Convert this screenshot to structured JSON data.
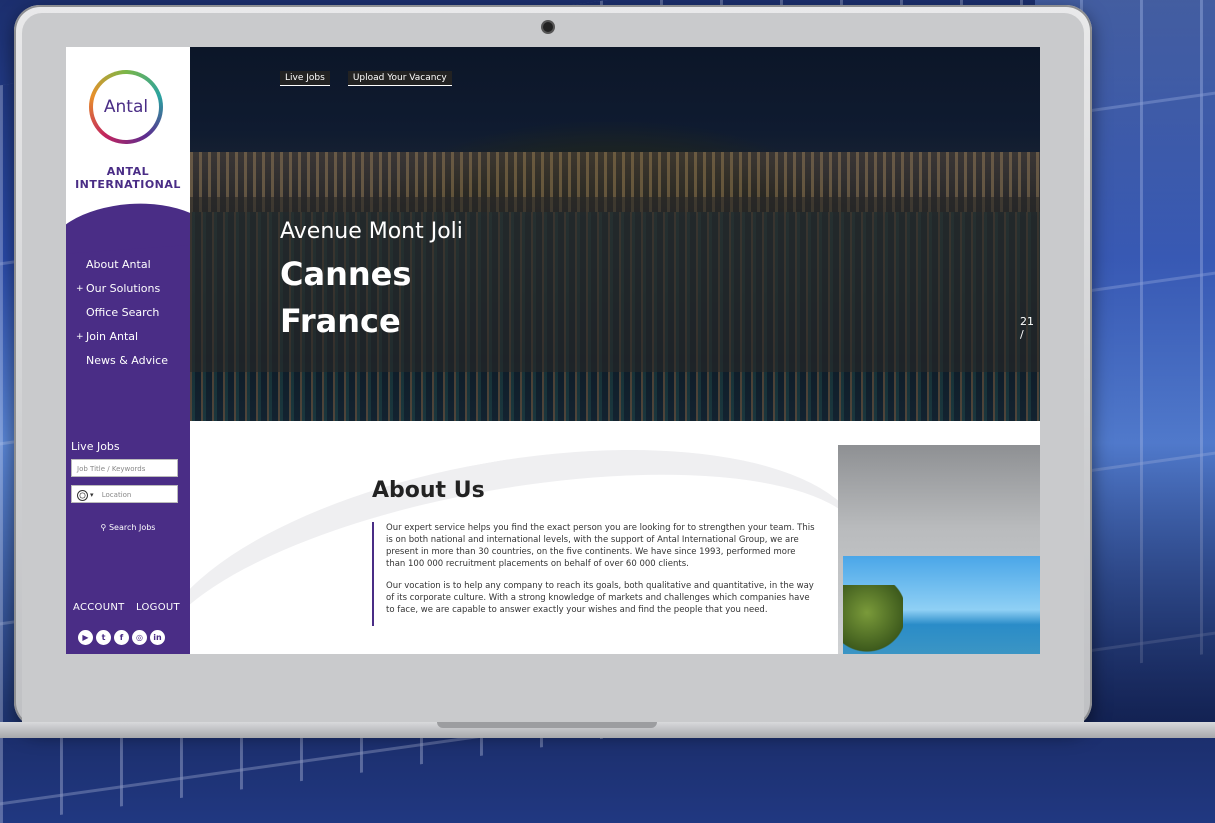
{
  "brand": {
    "logo_text": "Antal",
    "name_line1": "ANTAL",
    "name_line2": "INTERNATIONAL"
  },
  "nav": [
    {
      "label": "About Antal",
      "plus": false
    },
    {
      "label": "Our Solutions",
      "plus": true
    },
    {
      "label": "Office Search",
      "plus": false
    },
    {
      "label": "Join Antal",
      "plus": true
    },
    {
      "label": "News & Advice",
      "plus": false
    }
  ],
  "live_jobs": {
    "title": "Live Jobs",
    "keywords_placeholder": "Job Title / Keywords",
    "location_placeholder": "Location",
    "search_label": "Search Jobs"
  },
  "account": {
    "account_label": "ACCOUNT",
    "logout_label": "LOGOUT"
  },
  "socials": [
    {
      "icon": "youtube-icon",
      "glyph": "▶"
    },
    {
      "icon": "twitter-icon",
      "glyph": "t"
    },
    {
      "icon": "facebook-icon",
      "glyph": "f"
    },
    {
      "icon": "instagram-icon",
      "glyph": "◎"
    },
    {
      "icon": "linkedin-icon",
      "glyph": "in"
    }
  ],
  "hero": {
    "tab_live_jobs": "Live Jobs",
    "tab_upload": "Upload Your Vacancy",
    "street": "Avenue Mont Joli",
    "city": "Cannes",
    "country": "France",
    "counter": "21 /"
  },
  "about": {
    "title": "About Us",
    "p1": "Our expert service helps you find the exact person you are looking for to strengthen your team. This is on both national and international levels, with the support of Antal International Group, we are present in more than 30 countries, on the five continents. We have since 1993, performed more than 100 000 recruitment placements on behalf of over 60 000 clients.",
    "p2": "Our vocation is to help any company to reach its goals, both qualitative and quantitative, in the way of its corporate culture. With a strong knowledge of markets and challenges which companies have to face, we are capable to answer exactly your wishes and find the people that you need."
  },
  "colors": {
    "brand_purple": "#4a2d86"
  }
}
